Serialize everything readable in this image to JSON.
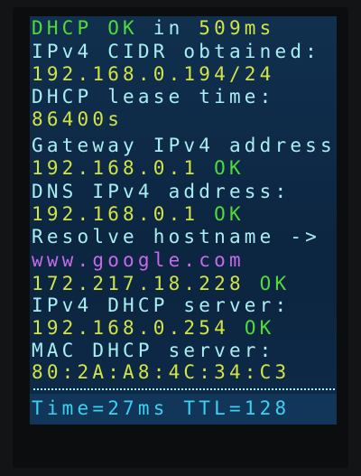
{
  "lines": [
    {
      "parts": [
        {
          "text": "DHCP OK",
          "color": "green"
        },
        {
          "text": " in ",
          "color": "cyan"
        },
        {
          "text": "509ms",
          "color": "yellow"
        }
      ]
    },
    {
      "parts": [
        {
          "text": "IPv4 CIDR obtained:",
          "color": "cyan"
        }
      ]
    },
    {
      "parts": [
        {
          "text": "192.168.0.194/24",
          "color": "yellow"
        }
      ]
    },
    {
      "parts": [
        {
          "text": "DHCP lease time:",
          "color": "cyan"
        }
      ]
    },
    {
      "parts": [
        {
          "text": "86400s",
          "color": "yellow"
        }
      ]
    },
    {
      "parts": [
        {
          "text": "Gateway IPv4 address",
          "color": "cyan"
        }
      ]
    },
    {
      "parts": [
        {
          "text": "192.168.0.1 ",
          "color": "yellow"
        },
        {
          "text": "OK",
          "color": "green"
        }
      ]
    },
    {
      "parts": [
        {
          "text": "DNS IPv4 address:",
          "color": "cyan"
        }
      ]
    },
    {
      "parts": [
        {
          "text": "192.168.0.1 ",
          "color": "yellow"
        },
        {
          "text": "OK",
          "color": "green"
        }
      ]
    },
    {
      "parts": [
        {
          "text": "Resolve hostname ->",
          "color": "cyan"
        }
      ]
    },
    {
      "parts": [
        {
          "text": "www.google.com",
          "color": "magenta"
        }
      ]
    },
    {
      "parts": [
        {
          "text": "172.217.18.228 ",
          "color": "yellow"
        },
        {
          "text": "OK",
          "color": "green"
        }
      ]
    },
    {
      "parts": [
        {
          "text": "IPv4 DHCP server:",
          "color": "cyan"
        }
      ]
    },
    {
      "parts": [
        {
          "text": "192.168.0.254 ",
          "color": "yellow"
        },
        {
          "text": "OK",
          "color": "green"
        }
      ]
    },
    {
      "parts": [
        {
          "text": "MAC DHCP server:",
          "color": "cyan"
        }
      ]
    },
    {
      "parts": [
        {
          "text": "80:2A:A8:4C:34:C3",
          "color": "yellow"
        }
      ]
    }
  ],
  "footer": {
    "text": "Time=27ms TTL=128"
  },
  "colors": {
    "cyan": "#a9eef2",
    "yellow": "#d2e345",
    "green": "#4fdc3a",
    "magenta": "#c56bea",
    "footer": "#39d3f0",
    "background": "#0f2a45"
  }
}
